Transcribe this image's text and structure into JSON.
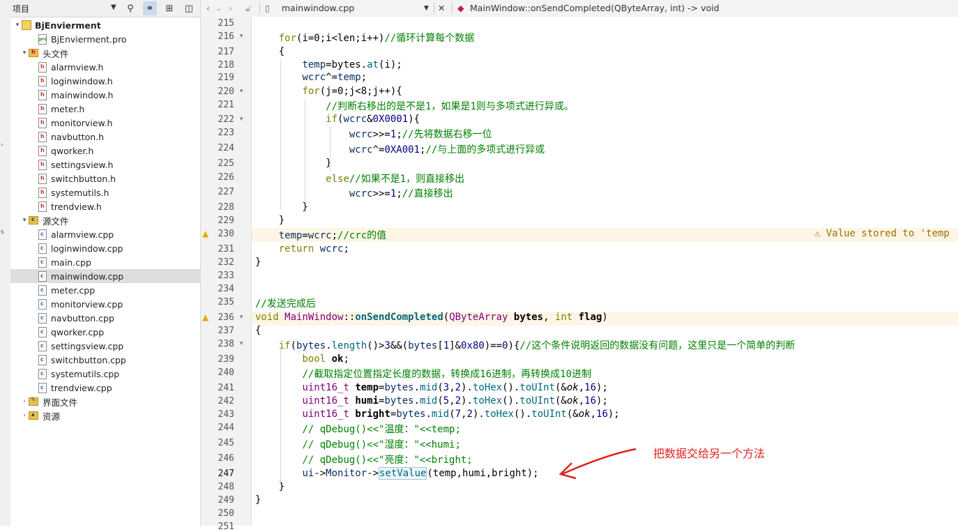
{
  "project_pane": {
    "title": "项目",
    "project": "BjEnvierment",
    "pro_file": "BjEnvierment.pro",
    "headers_folder": "头文件",
    "headers": [
      "alarmview.h",
      "loginwindow.h",
      "mainwindow.h",
      "meter.h",
      "monitorview.h",
      "navbutton.h",
      "qworker.h",
      "settingsview.h",
      "switchbutton.h",
      "systemutils.h",
      "trendview.h"
    ],
    "sources_folder": "源文件",
    "sources": [
      "alarmview.cpp",
      "loginwindow.cpp",
      "main.cpp",
      "mainwindow.cpp",
      "meter.cpp",
      "monitorview.cpp",
      "navbutton.cpp",
      "qworker.cpp",
      "settingsview.cpp",
      "switchbutton.cpp",
      "systemutils.cpp",
      "trendview.cpp"
    ],
    "selected": "mainwindow.cpp",
    "forms_folder": "界面文件",
    "resources_folder": "资源"
  },
  "editor": {
    "file": "mainwindow.cpp",
    "function": "MainWindow::onSendCompleted(QByteArray, int) -> void",
    "current_line": "247",
    "warning_text": "⚠ Value stored to 'temp",
    "line_numbers": [
      "215",
      "216",
      "217",
      "218",
      "219",
      "220",
      "221",
      "222",
      "223",
      "224",
      "225",
      "226",
      "227",
      "228",
      "229",
      "230",
      "231",
      "232",
      "233",
      "234",
      "235",
      "236",
      "237",
      "238",
      "239",
      "240",
      "241",
      "242",
      "243",
      "244",
      "245",
      "246",
      "247",
      "248",
      "249",
      "250",
      "251"
    ]
  },
  "annotation": "把数据交给另一个方法",
  "colors": {
    "keyword": "#808000",
    "type": "#800080",
    "comment": "#008000",
    "annotation": "#e02020",
    "warning": "#e6a800"
  }
}
